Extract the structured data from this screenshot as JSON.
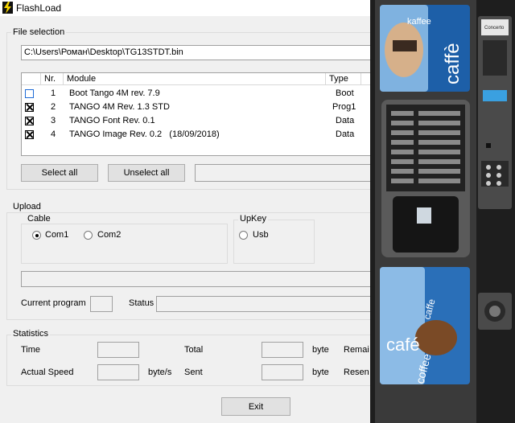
{
  "window": {
    "title": "FlashLoad"
  },
  "file_selection": {
    "group_label": "File selection",
    "path_value": "C:\\Users\\Роман\\Desktop\\TG13STDT.bin",
    "columns": [
      "Nr.",
      "Module",
      "Type"
    ],
    "rows": [
      {
        "checked": false,
        "nr": "1",
        "module": "Boot Tango 4M rev. 7.9",
        "type": "Boot"
      },
      {
        "checked": true,
        "nr": "2",
        "module": "TANGO 4M Rev. 1.3 STD",
        "type": "Prog1"
      },
      {
        "checked": true,
        "nr": "3",
        "module": "TANGO Font Rev. 0.1",
        "type": "Data"
      },
      {
        "checked": true,
        "nr": "4",
        "module": "TANGO Image Rev. 0.2   (18/09/2018)",
        "type": "Data"
      }
    ],
    "select_all_label": "Select all",
    "unselect_all_label": "Unselect all"
  },
  "upload": {
    "group_label": "Upload",
    "cable_label": "Cable",
    "com1_label": "Com1",
    "com2_label": "Com2",
    "upkey_label": "UpKey",
    "usb_label": "Usb",
    "selected": "Com1",
    "current_program_label": "Current program",
    "status_label": "Status"
  },
  "statistics": {
    "group_label": "Statistics",
    "time_label": "Time",
    "total_label": "Total",
    "total_unit": "byte",
    "remaining_label": "Remai",
    "actual_speed_label": "Actual Speed",
    "speed_unit": "byte/s",
    "sent_label": "Sent",
    "sent_unit": "byte",
    "resent_label": "Resen"
  },
  "exit_label": "Exit",
  "machine": {
    "top_panel_text": [
      "kaffee",
      "caffè"
    ],
    "bottom_panel_text": [
      "café",
      "caffe",
      "coffee"
    ],
    "display_brand": "Concerto"
  }
}
